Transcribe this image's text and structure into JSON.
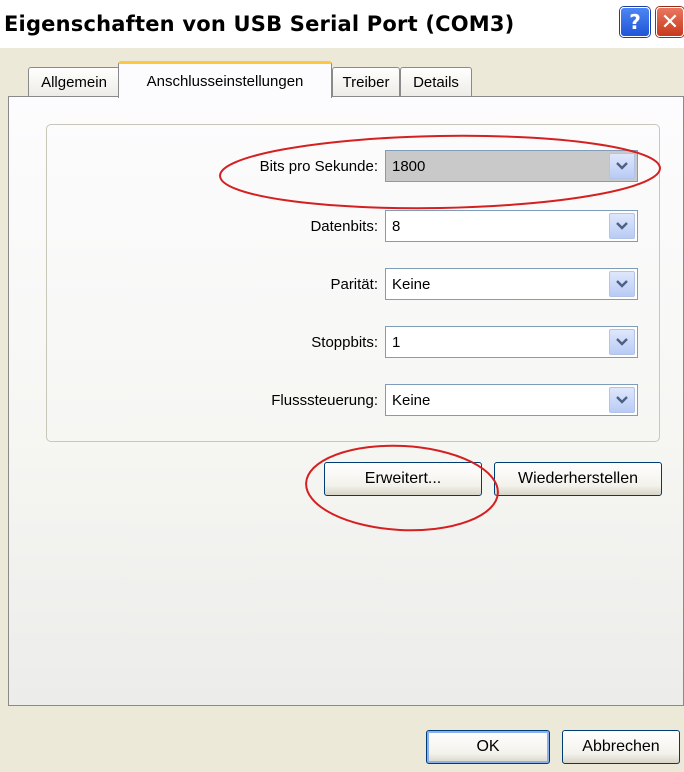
{
  "window": {
    "title": "Eigenschaften von USB Serial Port (COM3)"
  },
  "titlebar": {
    "help_symbol": "?",
    "close_symbol": "✕"
  },
  "tabs": [
    {
      "label": "Allgemein"
    },
    {
      "label": "Anschlusseinstellungen",
      "active": true
    },
    {
      "label": "Treiber"
    },
    {
      "label": "Details"
    }
  ],
  "settings": {
    "baud": {
      "label": "Bits pro Sekunde:",
      "value": "1800"
    },
    "databits": {
      "label": "Datenbits:",
      "value": "8"
    },
    "parity": {
      "label": "Parität:",
      "value": "Keine"
    },
    "stopbits": {
      "label": "Stoppbits:",
      "value": "1"
    },
    "flow": {
      "label": "Flusssteuerung:",
      "value": "Keine"
    }
  },
  "buttons": {
    "advanced": "Erweitert...",
    "restore": "Wiederherstellen",
    "ok": "OK",
    "cancel": "Abbrechen"
  },
  "colors": {
    "annotation": "#d42020",
    "title_bar_bg": "#ffffff",
    "dialog_bg": "#ece9d8",
    "active_tab_accent": "#ffc73d"
  },
  "icons": {
    "help": "help-icon",
    "close": "close-icon",
    "dropdown": "chevron-down-icon"
  }
}
